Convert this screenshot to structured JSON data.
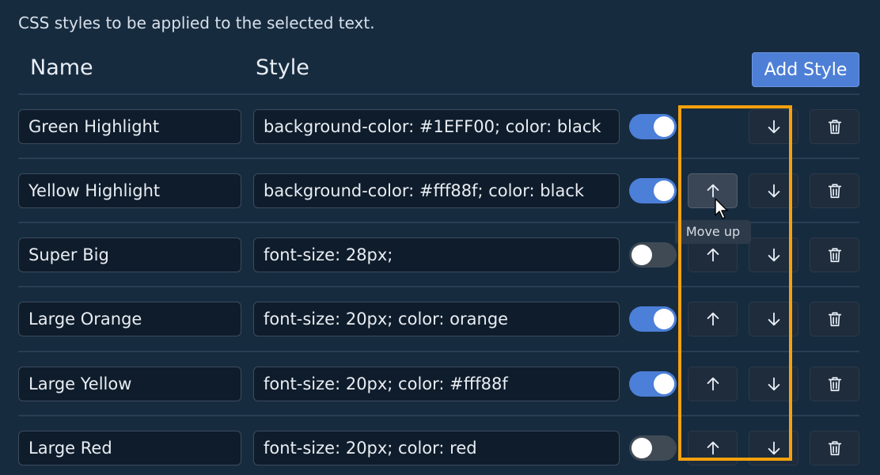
{
  "description": "CSS styles to be applied to the selected text.",
  "header": {
    "name_label": "Name",
    "style_label": "Style",
    "add_button": "Add Style"
  },
  "tooltip": "Move up",
  "rows": [
    {
      "name": "Green Highlight",
      "style": "background-color: #1EFF00; color: black",
      "enabled": true
    },
    {
      "name": "Yellow Highlight",
      "style": "background-color: #fff88f; color: black",
      "enabled": true
    },
    {
      "name": "Super Big",
      "style": "font-size: 28px;",
      "enabled": false
    },
    {
      "name": "Large Orange",
      "style": "font-size: 20px; color: orange",
      "enabled": true
    },
    {
      "name": "Large Yellow",
      "style": "font-size: 20px; color: #fff88f",
      "enabled": true
    },
    {
      "name": "Large Red",
      "style": "font-size: 20px; color: red",
      "enabled": false
    }
  ],
  "icons": {
    "up": "arrow-up-icon",
    "down": "arrow-down-icon",
    "delete": "trash-icon"
  },
  "colors": {
    "accent": "#4d7fd6",
    "highlight_box": "#f5a10d",
    "background": "#172b3f"
  }
}
